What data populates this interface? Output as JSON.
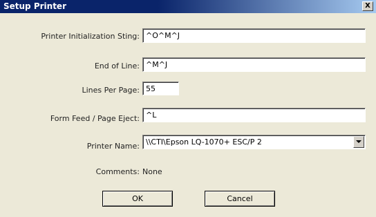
{
  "window": {
    "title": "Setup Printer",
    "close_glyph": "X"
  },
  "fields": {
    "init_label": "Printer Initialization Sting:",
    "init_value": "^O^M^J",
    "eol_label": "End of Line:",
    "eol_value": "^M^J",
    "lpp_label": "Lines Per Page:",
    "lpp_value": "55",
    "ff_label": "Form Feed / Page Eject:",
    "ff_value": "^L",
    "printer_label": "Printer Name:",
    "printer_value": "\\\\CTI\\Epson LQ-1070+ ESC/P 2",
    "comments_label": "Comments:",
    "comments_value": "None"
  },
  "buttons": {
    "ok_label": "OK",
    "cancel_label": "Cancel"
  },
  "colors": {
    "titlebar_start": "#0a246a",
    "titlebar_end": "#a6caf0",
    "dialog_bg": "#ece9d8"
  }
}
